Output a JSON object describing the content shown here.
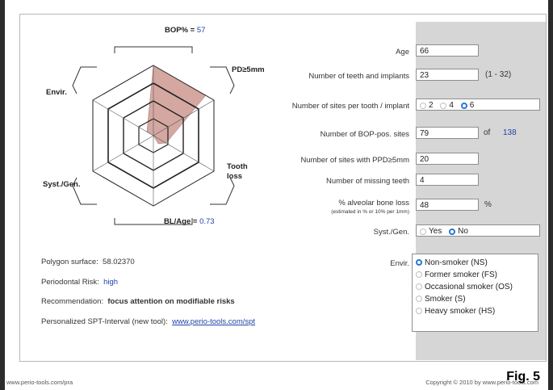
{
  "radar": {
    "axes": {
      "bop": {
        "label": "BOP% =",
        "value": "57"
      },
      "pd": {
        "label": "PD≥5mm"
      },
      "tooth_loss": {
        "label_1": "Tooth",
        "label_2": "loss"
      },
      "bl_age": {
        "label": "BL/Age =",
        "value": "0.73"
      },
      "syst_gen": {
        "label": "Syst./Gen."
      },
      "envir": {
        "label": "Envir."
      }
    }
  },
  "form": {
    "age": {
      "label": "Age",
      "value": "66"
    },
    "teeth": {
      "label": "Number of teeth and implants",
      "value": "23",
      "suffix": "(1 - 32)"
    },
    "sites_per_tooth": {
      "label": "Number of sites per tooth / implant",
      "options": [
        "2",
        "4",
        "6"
      ],
      "selected": "6"
    },
    "bop_sites": {
      "label": "Number of BOP-pos. sites",
      "value": "79",
      "of_label": "of",
      "total": "138"
    },
    "ppd_sites": {
      "label": "Number of sites with PPD≥5mm",
      "value": "20"
    },
    "missing_teeth": {
      "label": "Number of missing teeth",
      "value": "4"
    },
    "bone_loss": {
      "label": "% alveolar bone loss",
      "note": "(estimated in % or 10% per 1mm)",
      "value": "48",
      "suffix": "%"
    },
    "syst_gen": {
      "label": "Syst./Gen.",
      "options": [
        "Yes",
        "No"
      ],
      "selected": "No"
    },
    "envir": {
      "label": "Envir.",
      "options": [
        "Non-smoker (NS)",
        "Former smoker (FS)",
        "Occasional smoker (OS)",
        "Smoker (S)",
        "Heavy smoker (HS)"
      ],
      "selected": "Non-smoker (NS)"
    }
  },
  "results": {
    "polygon_label": "Polygon surface:",
    "polygon_value": "58.02370",
    "risk_label": "Periodontal Risk:",
    "risk_value": "high",
    "rec_label": "Recommendation:",
    "rec_value": "focus attention on modifiable risks",
    "spt_label": "Personalized SPT-Interval (new tool):",
    "spt_link": "www.perio-tools.com/spt"
  },
  "footer": {
    "left": "www.perio-tools.com/pra",
    "right": "Copyright © 2010 by www.perio-tools.com",
    "fig": "Fig. 5"
  },
  "colors": {
    "risk_polygon": "#c9928a",
    "link": "#1f44a6",
    "panel_shade": "#d6d6d6"
  }
}
